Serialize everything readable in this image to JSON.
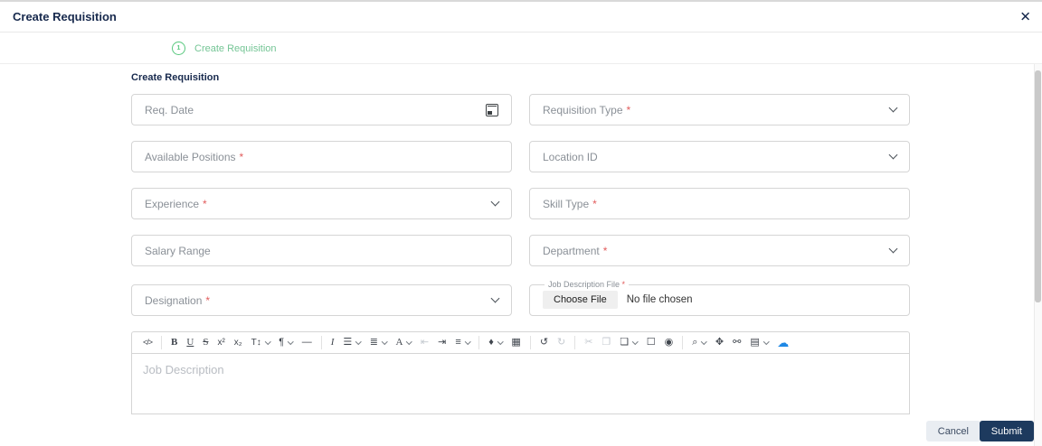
{
  "modal": {
    "title": "Create Requisition",
    "close_icon": "✕"
  },
  "stepper": {
    "step_number": "1",
    "label": "Create Requisition"
  },
  "content": {
    "section_title": "Create Requisition"
  },
  "form": {
    "required_marker": "*",
    "fields": [
      {
        "label": "Req. Date",
        "type": "date",
        "required": false
      },
      {
        "label": "Requisition Type",
        "type": "select",
        "required": true
      },
      {
        "label": "Available Positions",
        "type": "text",
        "required": true
      },
      {
        "label": "Location ID",
        "type": "select",
        "required": false
      },
      {
        "label": "Experience",
        "type": "select",
        "required": true
      },
      {
        "label": "Skill Type",
        "type": "text",
        "required": true
      },
      {
        "label": "Salary Range",
        "type": "text",
        "required": false
      },
      {
        "label": "Department",
        "type": "select",
        "required": true
      },
      {
        "label": "Designation",
        "type": "select",
        "required": true
      }
    ],
    "file_field": {
      "label": "Job Description File",
      "required": true,
      "button_label": "Choose File",
      "status_text": "No file chosen"
    }
  },
  "editor": {
    "placeholder": "Job Description",
    "toolbar": {
      "groups": [
        [
          {
            "name": "code-view-icon",
            "glyph": "</>"
          }
        ],
        [
          {
            "name": "bold-icon",
            "glyph": "B"
          },
          {
            "name": "underline-icon",
            "glyph": "U"
          },
          {
            "name": "strikethrough-icon",
            "glyph": "S"
          },
          {
            "name": "superscript-icon",
            "glyph": "x²"
          },
          {
            "name": "subscript-icon",
            "glyph": "x₂"
          },
          {
            "name": "font-size-icon",
            "glyph": "T↕",
            "chevron": true
          },
          {
            "name": "paragraph-icon",
            "glyph": "¶",
            "chevron": true
          },
          {
            "name": "horizontal-rule-icon",
            "glyph": "―"
          }
        ],
        [
          {
            "name": "italic-icon",
            "glyph": "I"
          },
          {
            "name": "unordered-list-icon",
            "glyph": "☰",
            "chevron": true
          },
          {
            "name": "ordered-list-icon",
            "glyph": "≣",
            "chevron": true
          },
          {
            "name": "font-color-icon",
            "glyph": "A",
            "chevron": true
          },
          {
            "name": "outdent-icon",
            "glyph": "⇤",
            "disabled": true
          },
          {
            "name": "indent-icon",
            "glyph": "⇥"
          },
          {
            "name": "align-icon",
            "glyph": "≡",
            "chevron": true
          }
        ],
        [
          {
            "name": "highlight-color-icon",
            "glyph": "♦",
            "chevron": true
          },
          {
            "name": "table-icon",
            "glyph": "▦"
          }
        ],
        [
          {
            "name": "undo-icon",
            "glyph": "↺"
          },
          {
            "name": "redo-icon",
            "glyph": "↻",
            "disabled": true
          }
        ],
        [
          {
            "name": "cut-icon",
            "glyph": "✂",
            "disabled": true
          },
          {
            "name": "copy-icon",
            "glyph": "❐",
            "disabled": true
          },
          {
            "name": "paste-icon",
            "glyph": "❏",
            "chevron": true
          },
          {
            "name": "select-all-icon",
            "glyph": "☐"
          },
          {
            "name": "preview-icon",
            "glyph": "◉"
          }
        ],
        [
          {
            "name": "search-icon",
            "glyph": "⌕",
            "chevron": true
          },
          {
            "name": "fullscreen-icon",
            "glyph": "✥"
          },
          {
            "name": "link-icon",
            "glyph": "⚯"
          },
          {
            "name": "media-icon",
            "glyph": "▤",
            "chevron": true
          },
          {
            "name": "upload-icon",
            "glyph": "☁"
          }
        ]
      ]
    }
  },
  "footer": {
    "cancel_label": "Cancel",
    "submit_label": "Submit"
  },
  "colors": {
    "accent_green": "#58c87e",
    "navy": "#17294d",
    "required_red": "#e25c5c",
    "upload_blue": "#1e88e5",
    "submit_bg": "#1d3a5e",
    "border_gray": "#d5d5d5"
  }
}
